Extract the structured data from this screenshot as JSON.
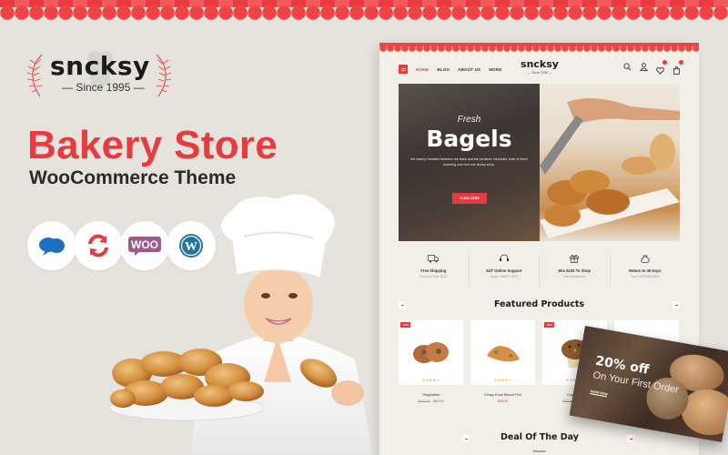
{
  "brand": {
    "name": "sncksy",
    "tagline": "— Since 1995 —"
  },
  "headline": {
    "title": "Bakery Store",
    "subtitle": "WooCommerce Theme"
  },
  "badges": [
    {
      "icon": "chat-bubble-icon",
      "label": "Support"
    },
    {
      "icon": "refresh-icon",
      "label": "Updates"
    },
    {
      "icon": "woocommerce-icon",
      "label": "WOO"
    },
    {
      "icon": "wordpress-icon",
      "label": "WordPress"
    }
  ],
  "colors": {
    "accent": "#e63b3f",
    "background": "#e6e3dd",
    "mockup_bg": "#f2efe8",
    "star": "#f5b301"
  },
  "mockup": {
    "nav": {
      "links": [
        "HOME",
        "BLOG",
        "ABOUT US",
        "MORE"
      ],
      "active": "HOME",
      "logo": "sncksy",
      "logo_sub": "— Since 1995 —",
      "icons": [
        "search-icon",
        "user-icon",
        "heart-icon",
        "cart-icon"
      ],
      "wishlist_count": "0",
      "cart_count": "0"
    },
    "hero": {
      "kicker": "Fresh",
      "title": "Bagels",
      "description": "the bakery huddled between the bank and the furniture merchant, both of them towering over the one storey shop.",
      "button": "CLICK HERE"
    },
    "features": [
      {
        "icon": "truck-icon",
        "title": "Free Shipping",
        "sub": "On Order Over $100"
      },
      {
        "icon": "headset-icon",
        "title": "24/7 Online Support",
        "sub": "Hours : 9AM To 5PM"
      },
      {
        "icon": "gift-icon",
        "title": "Win $100 To Shop",
        "sub": "Get Membership"
      },
      {
        "icon": "money-bag-icon",
        "title": "Return In 30 Days",
        "sub": "Call +1(407)456-8800"
      }
    ],
    "featured_title": "Featured Products",
    "products": [
      {
        "name": "Sfogliatella",
        "old_price": "$100.00",
        "price": "$90.00",
        "tag": "-10%",
        "rating": 4
      },
      {
        "name": "Crispy Khari Biscuit Roll",
        "old_price": "",
        "price": "$35.00",
        "tag": "",
        "rating": 4
      },
      {
        "name": "Cup Cake",
        "old_price": "$30.00",
        "price": "$15.00",
        "tag": "-50%",
        "rating": 5
      },
      {
        "name": "",
        "old_price": "",
        "price": "",
        "tag": "",
        "rating": 0
      }
    ],
    "promo": {
      "big": "20% off",
      "sub": "On Your First Order",
      "button": "SHOP NOW"
    },
    "deal_title": "Deal Of The Day",
    "deal_product": "Macaron"
  }
}
